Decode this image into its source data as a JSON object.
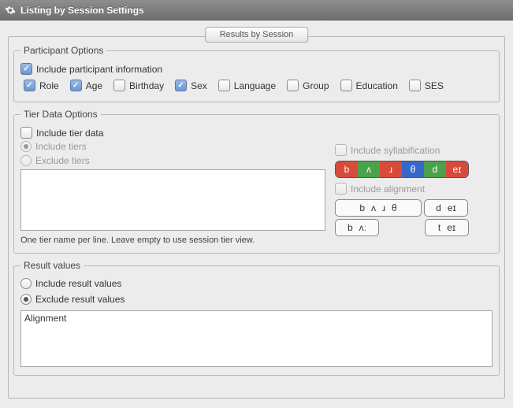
{
  "window": {
    "title": "Listing by Session Settings"
  },
  "tab": {
    "label": "Results by Session"
  },
  "participant": {
    "legend": "Participant Options",
    "include_label": "Include participant information",
    "fields": {
      "role": "Role",
      "age": "Age",
      "birthday": "Birthday",
      "sex": "Sex",
      "language": "Language",
      "group": "Group",
      "education": "Education",
      "ses": "SES"
    }
  },
  "tier": {
    "legend": "Tier Data Options",
    "include_data": "Include tier data",
    "include_tiers": "Include tiers",
    "exclude_tiers": "Exclude tiers",
    "hint": "One tier name per line. Leave empty to use session tier view.",
    "include_syll": "Include syllabification",
    "include_align": "Include alignment",
    "syll_cells": [
      "b",
      "ʌ",
      "ɹ",
      "θ",
      "d",
      "eɪ"
    ],
    "align_r1a": [
      "b",
      "ʌ",
      "ɹ",
      "θ"
    ],
    "align_r1b": [
      "d",
      "eɪ"
    ],
    "align_r2a": [
      "b",
      "ʌː"
    ],
    "align_r2b": [
      "t",
      "eɪ"
    ]
  },
  "result": {
    "legend": "Result values",
    "include": "Include result values",
    "exclude": "Exclude result values",
    "box_value": "Alignment"
  }
}
